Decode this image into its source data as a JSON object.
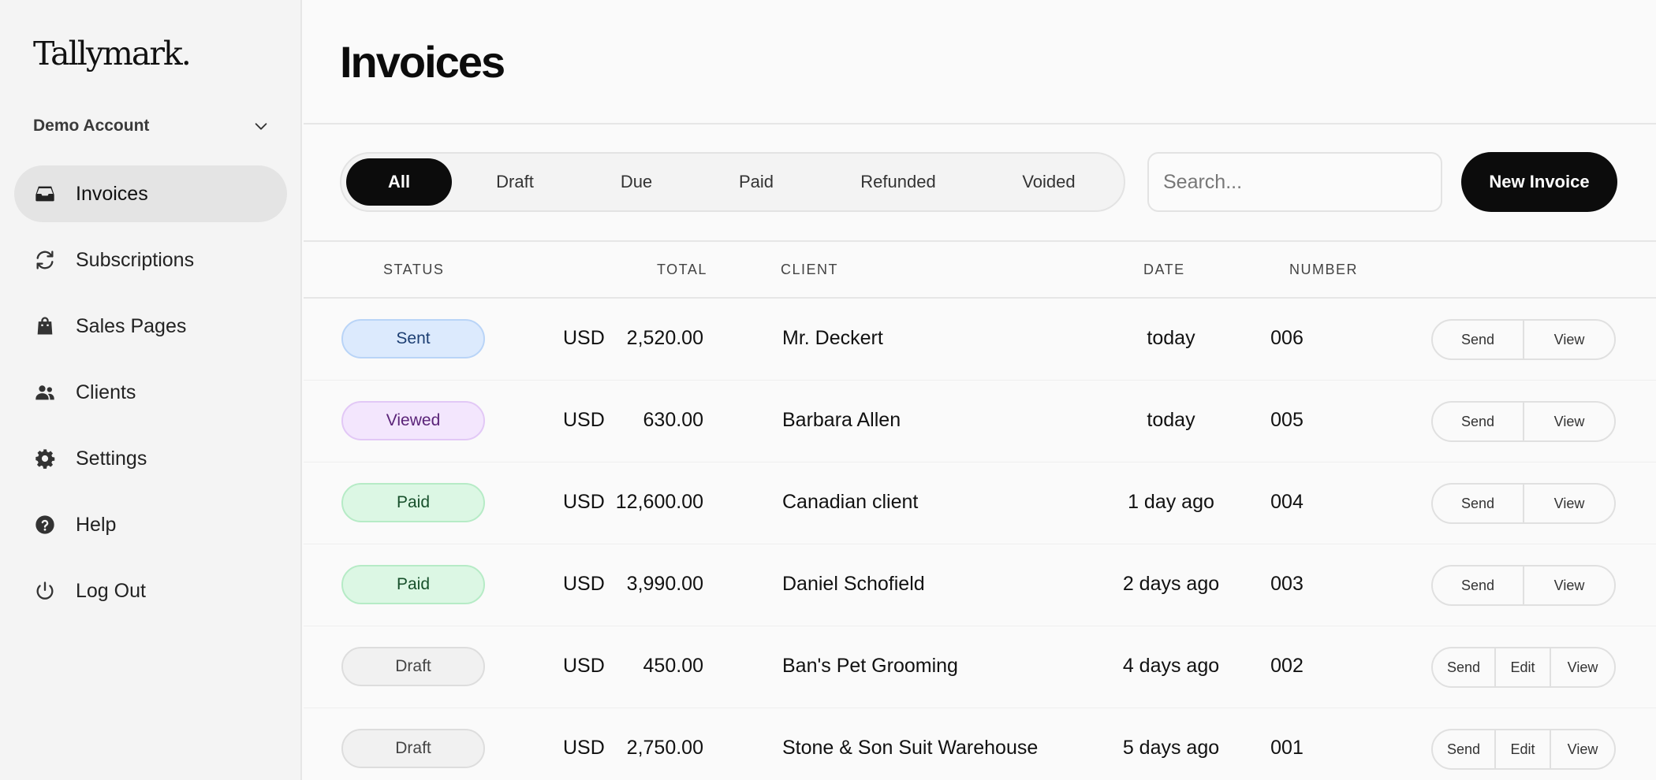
{
  "app": {
    "logo": "Tallymark."
  },
  "account": {
    "name": "Demo Account"
  },
  "nav": [
    {
      "label": "Invoices",
      "icon": "inbox-icon",
      "active": true
    },
    {
      "label": "Subscriptions",
      "icon": "refresh-icon",
      "active": false
    },
    {
      "label": "Sales Pages",
      "icon": "shopping-bag-icon",
      "active": false
    },
    {
      "label": "Clients",
      "icon": "users-icon",
      "active": false
    },
    {
      "label": "Settings",
      "icon": "gear-icon",
      "active": false
    },
    {
      "label": "Help",
      "icon": "help-circle-icon",
      "active": false
    },
    {
      "label": "Log Out",
      "icon": "power-icon",
      "active": false
    }
  ],
  "page": {
    "title": "Invoices"
  },
  "filters": {
    "tabs": [
      "All",
      "Draft",
      "Due",
      "Paid",
      "Refunded",
      "Voided"
    ],
    "active": "All"
  },
  "search": {
    "placeholder": "Search..."
  },
  "new_invoice": {
    "label": "New Invoice"
  },
  "table": {
    "headers": {
      "status": "STATUS",
      "total": "TOTAL",
      "client": "CLIENT",
      "date": "DATE",
      "number": "NUMBER"
    },
    "rows": [
      {
        "status": "Sent",
        "currency": "USD",
        "amount": "2,520.00",
        "client": "Mr. Deckert",
        "date": "today",
        "number": "006",
        "actions": [
          "Send",
          "View"
        ]
      },
      {
        "status": "Viewed",
        "currency": "USD",
        "amount": "630.00",
        "client": "Barbara Allen",
        "date": "today",
        "number": "005",
        "actions": [
          "Send",
          "View"
        ]
      },
      {
        "status": "Paid",
        "currency": "USD",
        "amount": "12,600.00",
        "client": "Canadian client",
        "date": "1 day ago",
        "number": "004",
        "actions": [
          "Send",
          "View"
        ]
      },
      {
        "status": "Paid",
        "currency": "USD",
        "amount": "3,990.00",
        "client": "Daniel Schofield",
        "date": "2 days ago",
        "number": "003",
        "actions": [
          "Send",
          "View"
        ]
      },
      {
        "status": "Draft",
        "currency": "USD",
        "amount": "450.00",
        "client": "Ban's Pet Grooming",
        "date": "4 days ago",
        "number": "002",
        "actions": [
          "Send",
          "Edit",
          "View"
        ]
      },
      {
        "status": "Draft",
        "currency": "USD",
        "amount": "2,750.00",
        "client": "Stone & Son Suit Warehouse",
        "date": "5 days ago",
        "number": "001",
        "actions": [
          "Send",
          "Edit",
          "View"
        ]
      }
    ]
  },
  "status_colors": {
    "Sent": {
      "bg": "#dceafd",
      "border": "#b9d4f7",
      "text": "#1d3f73"
    },
    "Viewed": {
      "bg": "#f3e6fd",
      "border": "#e2c8f6",
      "text": "#5a2378"
    },
    "Paid": {
      "bg": "#dcf7e4",
      "border": "#b6ebc6",
      "text": "#17502b"
    },
    "Draft": {
      "bg": "#f1f1f1",
      "border": "#dddddd",
      "text": "#444444"
    }
  }
}
